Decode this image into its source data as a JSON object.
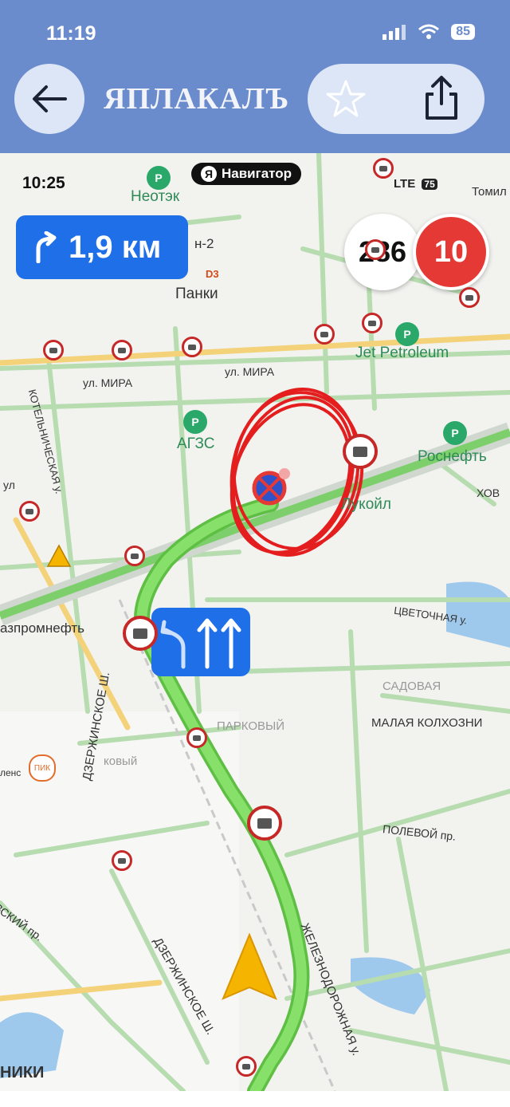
{
  "status_bar": {
    "time": "11:19",
    "battery": "85"
  },
  "header": {
    "logo_text": "ЯПЛАКАЛЪ"
  },
  "navigator": {
    "inner_time": "10:25",
    "app_badge": "Навигатор",
    "app_badge_letter": "Я",
    "network": "LTE",
    "inner_battery": "75",
    "maneuver_distance": "1,9 км",
    "current_speed": "286",
    "speed_limit": "10"
  },
  "map_labels": {
    "panki": "Панки",
    "neotek": "Неотэк",
    "tomilino": "Томил",
    "n2": "н-2",
    "d3": "D3",
    "jet": "Jet Petroleum",
    "ul_mira_1": "ул. МИРА",
    "ul_mira_2": "ул. МИРА",
    "kotel": "КОТЕЛЬНИЧЕСКАЯ у.",
    "agzs": "АГЗС",
    "rosneft": "Роснефть",
    "lukoil": "Лукойл",
    "hov": "ХОВ",
    "gazprom": "азпромнефть",
    "tsvetoch": "ЦВЕТОЧНАЯ у.",
    "sadovaya": "САДОВАЯ",
    "parkovy": "ПАРКОВЫЙ",
    "malaya": "МАЛАЯ КОЛХОЗНИ",
    "dzerzh1": "ДЗЕРЖИНСКОЕ Ш.",
    "dzerzh2": "ДЗЕРЖИНСКОЕ Ш.",
    "polevoy": "ПОЛЕВОЙ пр.",
    "pik": "ПИК",
    "plenik": "ленс",
    "zheleznodor": "ЖЕЛЕЗНОДОРОЖНАЯ у.",
    "vsky": "ВСКИЙ пр.",
    "niki": "НИКИ",
    "ul": "ул",
    "vyy": "ковый"
  },
  "colors": {
    "header_bg": "#6b8ccc",
    "route": "#6dd14e",
    "maneuver": "#1e6fe8",
    "limit": "#e53935",
    "annotation": "#e41e1e"
  }
}
